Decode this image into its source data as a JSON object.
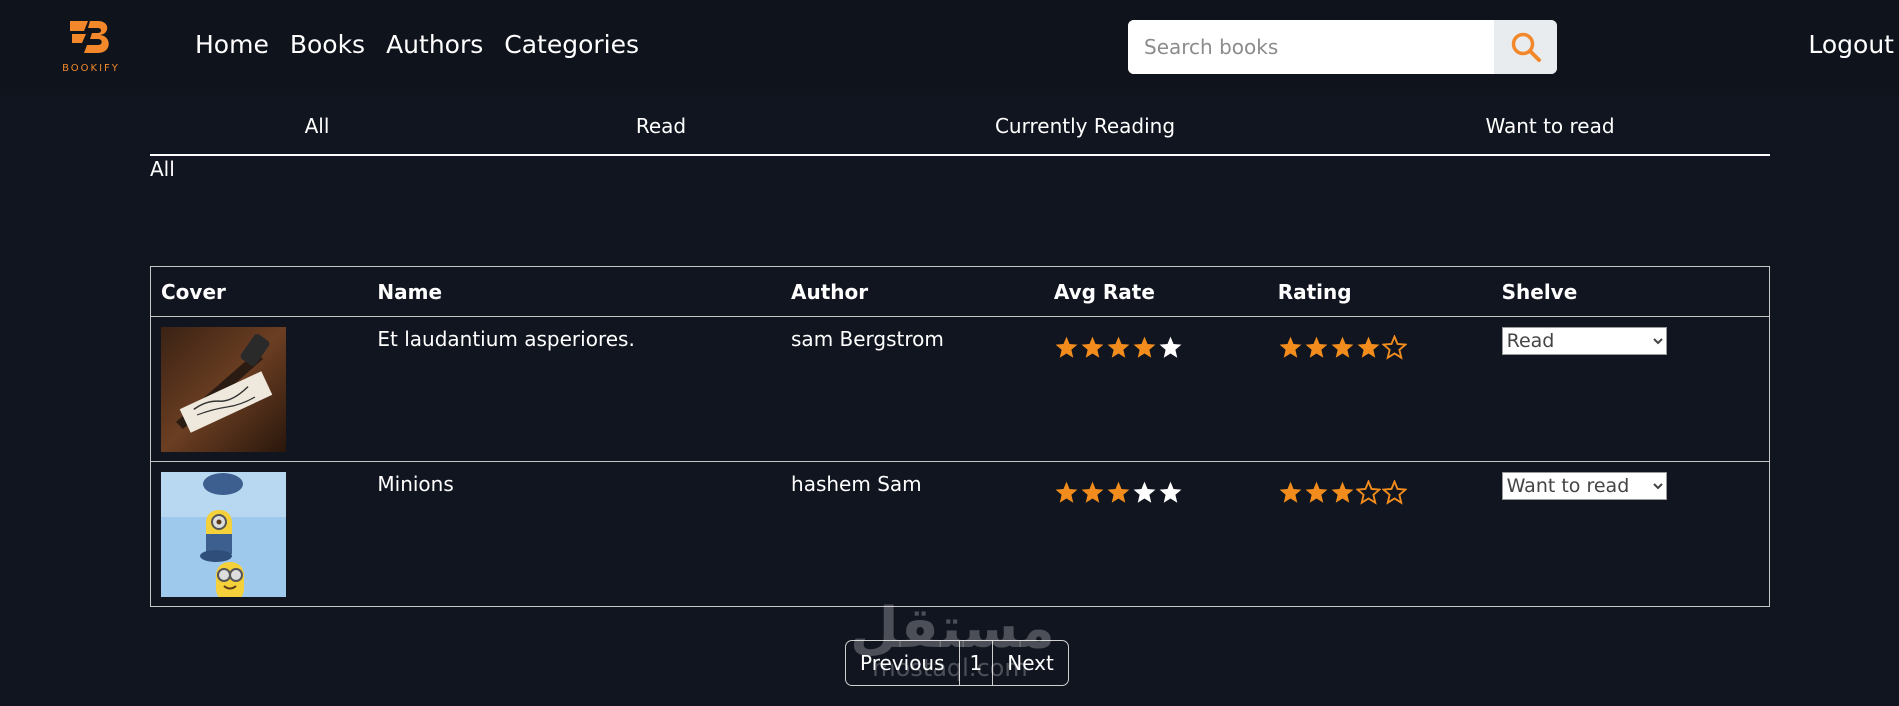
{
  "brand": {
    "name": "BOOKIFY",
    "accent": "#f2882a"
  },
  "nav": {
    "items": [
      "Home",
      "Books",
      "Authors",
      "Categories"
    ],
    "logout": "Logout"
  },
  "search": {
    "placeholder": "Search books",
    "icon": "search-icon"
  },
  "shelves": {
    "tabs": [
      "All",
      "Read",
      "Currently Reading",
      "Want to read"
    ],
    "current": "All"
  },
  "table": {
    "headers": [
      "Cover",
      "Name",
      "Author",
      "Avg Rate",
      "Rating",
      "Shelve"
    ],
    "rows": [
      {
        "name": "Et laudantium asperiores.",
        "author": "sam Bergstrom",
        "avg_rate": 4,
        "rating": 4,
        "shelve": "Read"
      },
      {
        "name": "Minions",
        "author": "hashem Sam",
        "avg_rate": 3,
        "rating": 3,
        "shelve": "Want to read"
      }
    ],
    "rating_max": 5
  },
  "pagination": {
    "previous": "Previous",
    "page": "1",
    "next": "Next"
  },
  "watermark": {
    "arabic": "مستقل",
    "latin": "mostaql.com"
  },
  "colors": {
    "background": "#11151f",
    "star_filled": "#f28d1d",
    "star_empty": "#ffffff"
  }
}
